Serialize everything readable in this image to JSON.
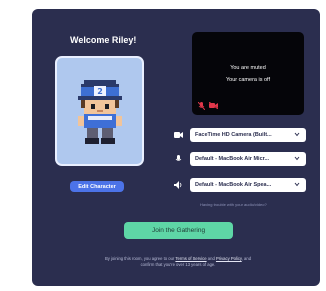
{
  "welcome": "Welcome Riley!",
  "character": {
    "edit_label": "Edit Character",
    "hat_number": "2"
  },
  "preview": {
    "muted_text": "You are muted",
    "camera_off_text": "Your camera is off"
  },
  "devices": {
    "camera": {
      "value": "FaceTime HD Camera (Built...",
      "icon": "video-camera-icon"
    },
    "microphone": {
      "value": "Default - MacBook Air Micr...",
      "icon": "microphone-icon"
    },
    "speaker": {
      "value": "Default - MacBook Air Spea...",
      "icon": "speaker-icon"
    }
  },
  "trouble_text": "Having trouble with your audio/video?",
  "join_label": "Join the Gathering",
  "legal": {
    "prefix": "By joining this room, you agree to our",
    "terms": "Terms of Service",
    "and": "and",
    "privacy": "Privacy Policy",
    "suffix": ", and confirm that you're over 13 years of age."
  },
  "colors": {
    "card": "#2b2e4f",
    "accent_button": "#4c73e8",
    "join_button": "#5ed6a6",
    "character_bg": "#afc8ee",
    "muted_icon": "#e0374a"
  }
}
